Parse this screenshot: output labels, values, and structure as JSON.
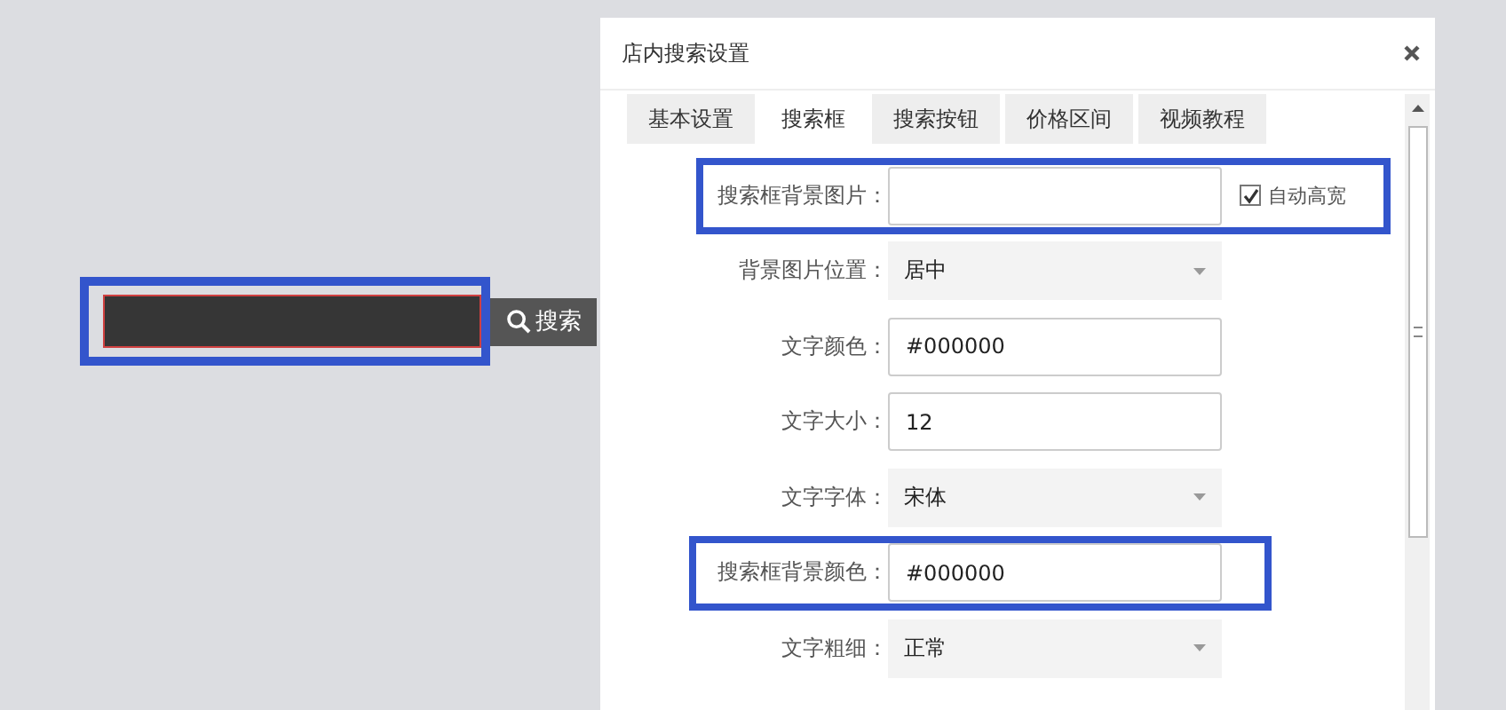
{
  "preview": {
    "highlighted": true,
    "button": "搜索"
  },
  "dialog": {
    "title": "店内搜索设置",
    "tabs": [
      {
        "label": "基本设置",
        "selected": false
      },
      {
        "label": "搜索框",
        "selected": true
      },
      {
        "label": "搜索按钮",
        "selected": false
      },
      {
        "label": "价格区间",
        "selected": false
      },
      {
        "label": "视频教程",
        "selected": false
      }
    ],
    "rows": [
      {
        "kind": "input",
        "label": "搜索框背景图片：",
        "highlighted": true,
        "checkbox": {
          "label": "自动高宽",
          "checked": true
        }
      },
      {
        "kind": "select",
        "label": "背景图片位置：",
        "value": "居中",
        "highlighted": false
      },
      {
        "kind": "input",
        "label": "文字颜色：",
        "value": "#000000",
        "highlighted": false
      },
      {
        "kind": "input",
        "label": "文字大小：",
        "value": "12",
        "highlighted": false
      },
      {
        "kind": "select",
        "label": "文字字体：",
        "value": "宋体",
        "highlighted": false
      },
      {
        "kind": "input",
        "label": "搜索框背景颜色：",
        "value": "#000000",
        "highlighted": true
      },
      {
        "kind": "select",
        "label": "文字粗细：",
        "value": "正常",
        "highlighted": false
      }
    ]
  }
}
